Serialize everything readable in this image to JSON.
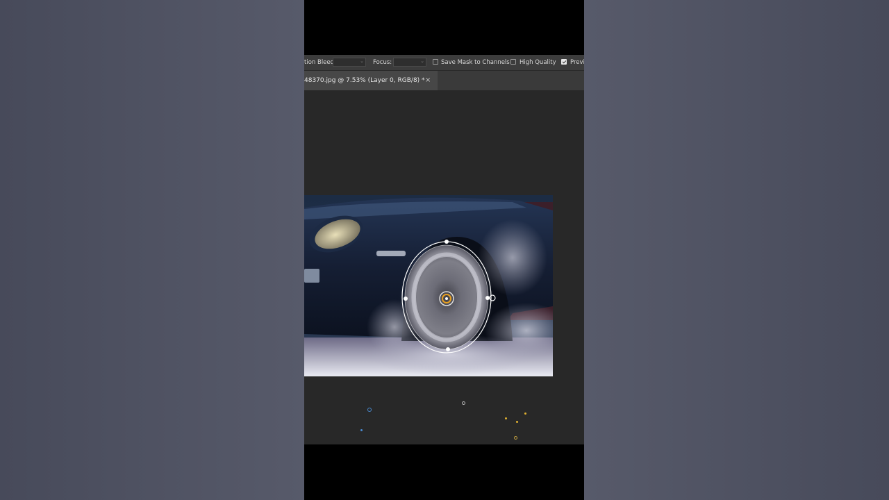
{
  "options_bar": {
    "motion_bleed_label": "tion Bleed:",
    "focus_label": "Focus:",
    "save_mask_label": "Save Mask to Channels",
    "save_mask_checked": false,
    "high_quality_label": "High Quality",
    "high_quality_checked": false,
    "preview_label": "Previ",
    "preview_checked": true
  },
  "document_tab": {
    "title": "48370.jpg @ 7.53% (Layer 0, RGB/8) *",
    "close_glyph": "×"
  },
  "colors": {
    "canvas_bg": "#282828",
    "toolbar_bg": "#3c3c3c",
    "tab_active_bg": "#474747",
    "overlay_pin": "#e8a020"
  },
  "icons": [
    "chevron-down-icon",
    "close-icon",
    "checkbox-icon",
    "blur-pin-icon"
  ]
}
